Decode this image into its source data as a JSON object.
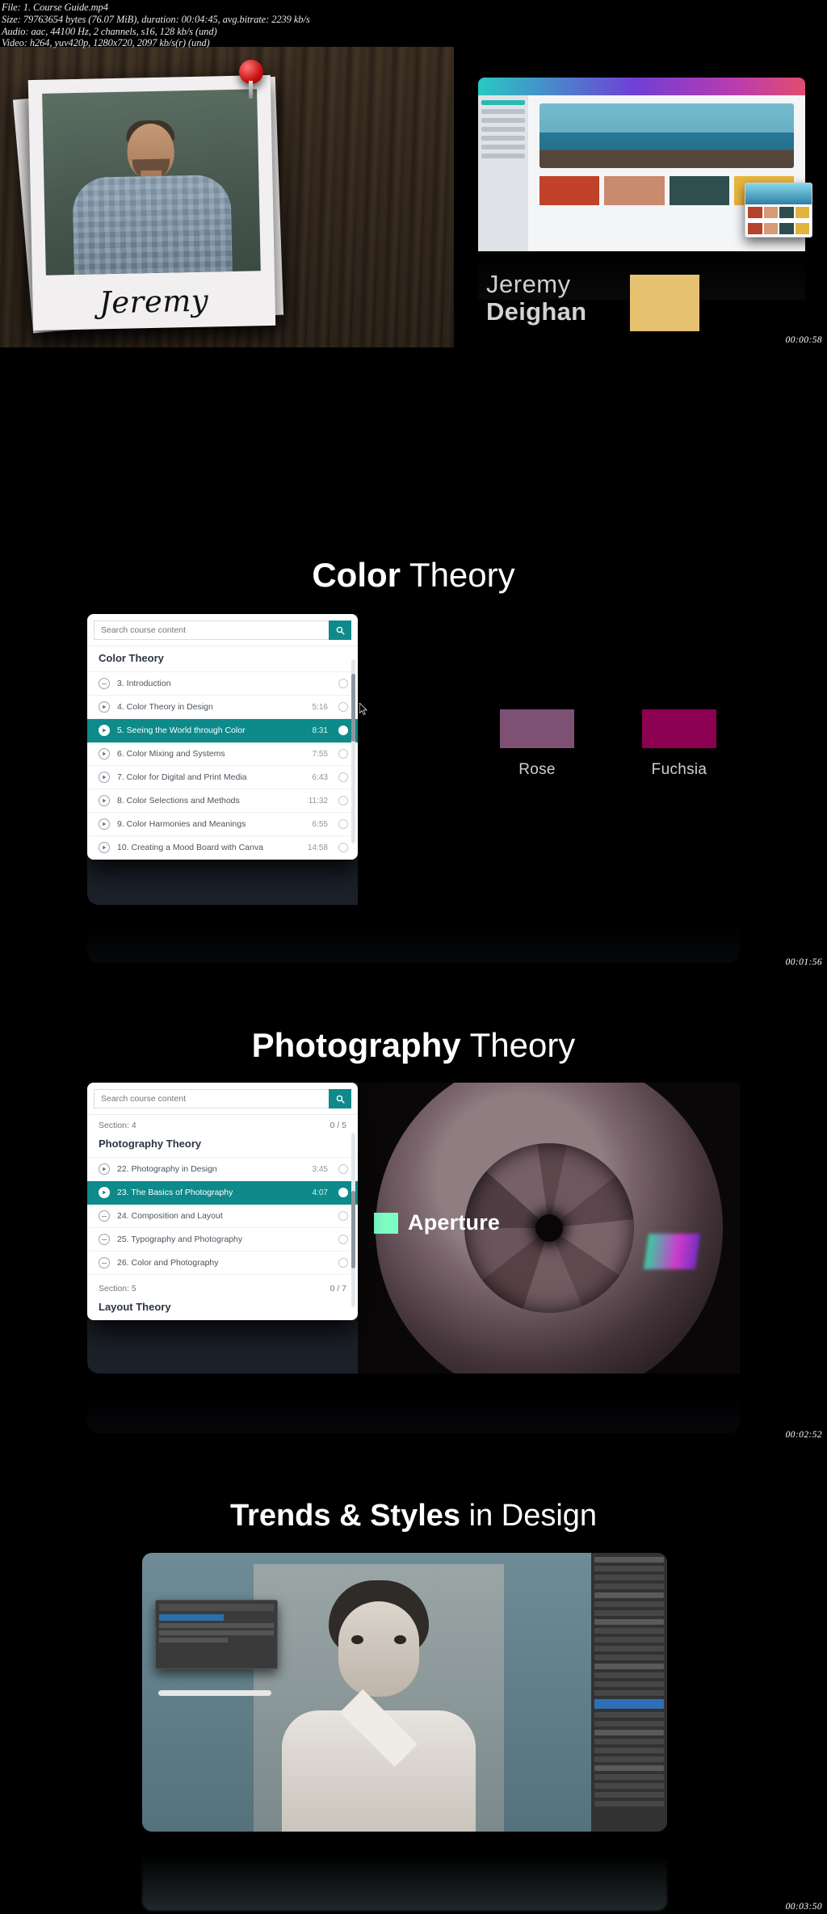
{
  "meta": {
    "line1": "File: 1. Course Guide.mp4",
    "line2": "Size: 79763654 bytes (76.07 MiB), duration: 00:04:45, avg.bitrate: 2239 kb/s",
    "line3": "Audio: aac, 44100 Hz, 2 channels, s16, 128 kb/s (und)",
    "line4": "Video: h264, yuv420p, 1280x720, 2097 kb/s(r) (und)"
  },
  "colors": {
    "accent_teal": "#0e8a8a",
    "gold": "#e5c170",
    "rose": "#7d5074",
    "fuchsia": "#8b0051",
    "mint": "#7dfcc4"
  },
  "frames": [
    {
      "name": "intro",
      "timestamp": "00:00:58",
      "polaroid_signature": "Jeremy",
      "title_first": "Jeremy",
      "title_last": "Deighan",
      "browser_swatches": [
        "#c0422a",
        "#c98a6e",
        "#2f4f4f",
        "#e8b63c"
      ],
      "float_swatches": [
        "#b5432c",
        "#d79a74",
        "#2e4d4d",
        "#e2b43d"
      ]
    },
    {
      "name": "color-theory",
      "timestamp": "00:01:56",
      "title_bold": "Color",
      "title_light": " Theory",
      "search_placeholder": "Search course content",
      "group_title": "Color Theory",
      "lessons": [
        {
          "icon": "collapse-icon",
          "label": "3. Introduction",
          "duration": "",
          "active": false
        },
        {
          "icon": "play-icon",
          "label": "4. Color Theory in Design",
          "duration": "5:16",
          "active": false
        },
        {
          "icon": "play-icon",
          "label": "5. Seeing the World through Color",
          "duration": "8:31",
          "active": true
        },
        {
          "icon": "play-icon",
          "label": "6. Color Mixing and Systems",
          "duration": "7:55",
          "active": false
        },
        {
          "icon": "play-icon",
          "label": "7. Color for Digital and Print Media",
          "duration": "6:43",
          "active": false
        },
        {
          "icon": "play-icon",
          "label": "8. Color Selections and Methods",
          "duration": "11:32",
          "active": false
        },
        {
          "icon": "play-icon",
          "label": "9. Color Harmonies and Meanings",
          "duration": "6:55",
          "active": false
        },
        {
          "icon": "play-icon",
          "label": "10. Creating a Mood Board with Canva",
          "duration": "14:58",
          "active": false
        }
      ],
      "swatches": [
        {
          "label": "Rose",
          "color": "#7d5074"
        },
        {
          "label": "Fuchsia",
          "color": "#8b0051"
        }
      ]
    },
    {
      "name": "photography-theory",
      "timestamp": "00:02:52",
      "title_bold": "Photography",
      "title_light": " Theory",
      "search_placeholder": "Search course content",
      "section_label": "Section: 4",
      "section_progress": "0 / 5",
      "group_title": "Photography Theory",
      "lessons": [
        {
          "icon": "play-icon",
          "label": "22. Photography in Design",
          "duration": "3:45",
          "active": false
        },
        {
          "icon": "play-icon",
          "label": "23. The Basics of Photography",
          "duration": "4:07",
          "active": true
        },
        {
          "icon": "collapse-icon",
          "label": "24. Composition and Layout",
          "duration": "",
          "active": false
        },
        {
          "icon": "collapse-icon",
          "label": "25. Typography and Photography",
          "duration": "",
          "active": false
        },
        {
          "icon": "collapse-icon",
          "label": "26. Color and Photography",
          "duration": "",
          "active": false
        }
      ],
      "next_section_label": "Section: 5",
      "next_section_progress": "0 / 7",
      "next_group_title": "Layout Theory",
      "overlay_label": "Aperture"
    },
    {
      "name": "trends-styles",
      "timestamp": "00:03:50",
      "title_bold": "Trends & Styles",
      "title_light": " in Design"
    }
  ]
}
